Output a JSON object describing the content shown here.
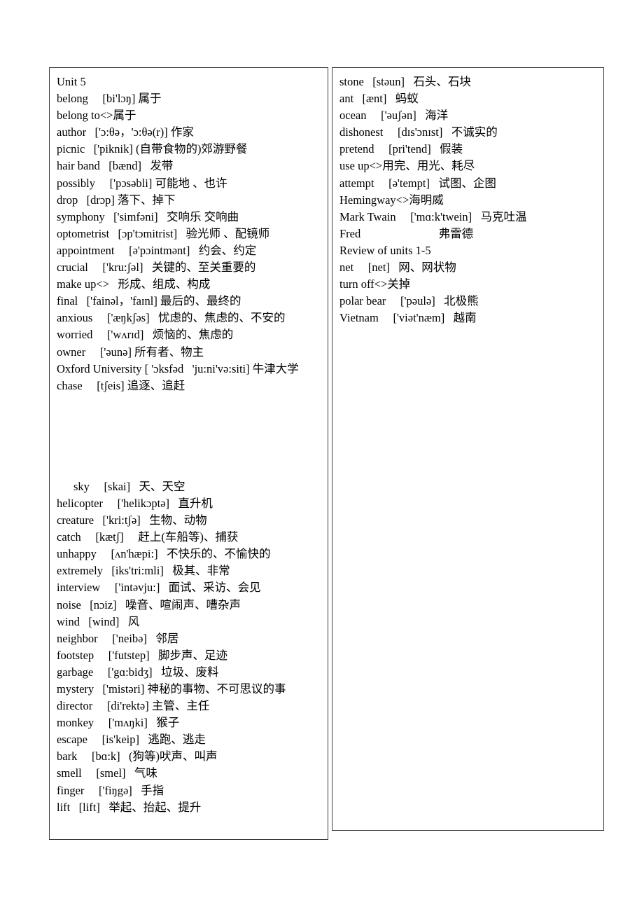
{
  "document": {
    "type": "vocabulary-list",
    "title_line": "Unit 5",
    "columns": [
      {
        "id": "left-column",
        "entries": [
          {
            "text": "Unit 5",
            "indent": false
          },
          {
            "text": "belong  [bi'lɔŋ] 属于",
            "indent": false
          },
          {
            "text": "belong to<>属于",
            "indent": false
          },
          {
            "text": "author  ['ɔ:θə，'ɔ:θə(r)] 作家",
            "indent": false
          },
          {
            "text": "picnic  ['piknik] (自带食物的)郊游野餐",
            "indent": false
          },
          {
            "text": "hair band  [bænd]  发带",
            "indent": false
          },
          {
            "text": "possibly  ['pɔsəbli] 可能地 、也许",
            "indent": false
          },
          {
            "text": "drop  [drɔp] 落下、掉下",
            "indent": false
          },
          {
            "text": "symphony  ['simfəni]  交响乐 交响曲",
            "indent": false
          },
          {
            "text": "optometrist  [ɔp'tɔmitrist]  验光师 、配镜师",
            "indent": false
          },
          {
            "text": "appointment  [ə'pɔintmənt]  约会、约定",
            "indent": false
          },
          {
            "text": "crucial  ['kru:ʃəl]  关键的、至关重要的",
            "indent": false
          },
          {
            "text": "make up<>  形成、组成、构成",
            "indent": false
          },
          {
            "text": "final  ['fainəl，'faɪnl] 最后的、最终的",
            "indent": false
          },
          {
            "text": "anxious  ['æŋkʃəs]  忧虑的、焦虑的、不安的",
            "indent": false
          },
          {
            "text": "worried  ['wʌrɪd]  烦恼的、焦虑的",
            "indent": false
          },
          {
            "text": "owner  ['əunə] 所有者、物主",
            "indent": false
          },
          {
            "text": "Oxford University [ 'ɔksfəd  'ju:ni'və:siti] 牛津大学",
            "indent": false
          },
          {
            "text": "chase  [tʃeis] 追逐、追赶",
            "indent": false
          },
          {
            "text": "",
            "indent": false,
            "blank": true
          },
          {
            "text": "sky  [skai]  天、天空",
            "indent": true
          },
          {
            "text": "helicopter  ['helikɔptə]  直升机",
            "indent": false
          },
          {
            "text": "creature  ['kri:tʃə]  生物、动物",
            "indent": false
          },
          {
            "text": "catch  [kætʃ]  赶上(车船等)、捕获",
            "indent": false
          },
          {
            "text": "unhappy  [ʌn'hæpi:]  不快乐的、不愉快的",
            "indent": false
          },
          {
            "text": "extremely  [iks'tri:mli]  极其、非常",
            "indent": false
          },
          {
            "text": "interview  ['intəvju:]  面试、采访、会见",
            "indent": false
          },
          {
            "text": "noise  [nɔiz]  噪音、喧闹声、嘈杂声",
            "indent": false
          },
          {
            "text": "wind  [wind]  风",
            "indent": false
          },
          {
            "text": "neighbor  ['neibə]  邻居",
            "indent": false
          },
          {
            "text": "footstep  ['futstep]  脚步声、足迹",
            "indent": false
          },
          {
            "text": "garbage  ['gɑ:bidʒ]  垃圾、废料",
            "indent": false
          },
          {
            "text": "mystery  ['mistəri] 神秘的事物、不可思议的事",
            "indent": false
          },
          {
            "text": "director  [di'rektə] 主管、主任",
            "indent": false
          },
          {
            "text": "monkey  ['mʌŋki]  猴子",
            "indent": false
          },
          {
            "text": "escape  [is'keip]  逃跑、逃走",
            "indent": false
          },
          {
            "text": "bark  [bɑ:k]  (狗等)吠声、叫声",
            "indent": false
          },
          {
            "text": "smell  [smel]  气味",
            "indent": false
          },
          {
            "text": "finger  ['fiŋgə]  手指",
            "indent": false
          },
          {
            "text": "lift  [lift]  举起、抬起、提升",
            "indent": false
          }
        ]
      },
      {
        "id": "right-column",
        "entries": [
          {
            "text": "stone  [stəun]  石头、石块",
            "indent": false
          },
          {
            "text": "ant  [ænt]  蚂蚁",
            "indent": false
          },
          {
            "text": "ocean  ['əuʃən]  海洋",
            "indent": false
          },
          {
            "text": "dishonest  [dɪs'ɔnɪst]  不诚实的",
            "indent": false
          },
          {
            "text": "pretend  [pri'tend]  假装",
            "indent": false
          },
          {
            "text": "use up<>用完、用光、耗尽",
            "indent": false
          },
          {
            "text": "attempt  [ə'tempt]  试图、企图",
            "indent": false
          },
          {
            "text": "Hemingway<>海明威",
            "indent": false
          },
          {
            "text": "Mark Twain  ['mɑ:k'twein]  马克吐温",
            "indent": false
          },
          {
            "text": "Fred        弗雷德",
            "indent": false
          },
          {
            "text": "Review of units 1-5",
            "indent": false
          },
          {
            "text": "net  [net]  网、网状物",
            "indent": false
          },
          {
            "text": "turn off<>关掉",
            "indent": false
          },
          {
            "text": "polar bear  ['pəulə]  北极熊",
            "indent": false
          },
          {
            "text": "Vietnam  ['viət'næm]  越南",
            "indent": false
          }
        ]
      }
    ]
  }
}
